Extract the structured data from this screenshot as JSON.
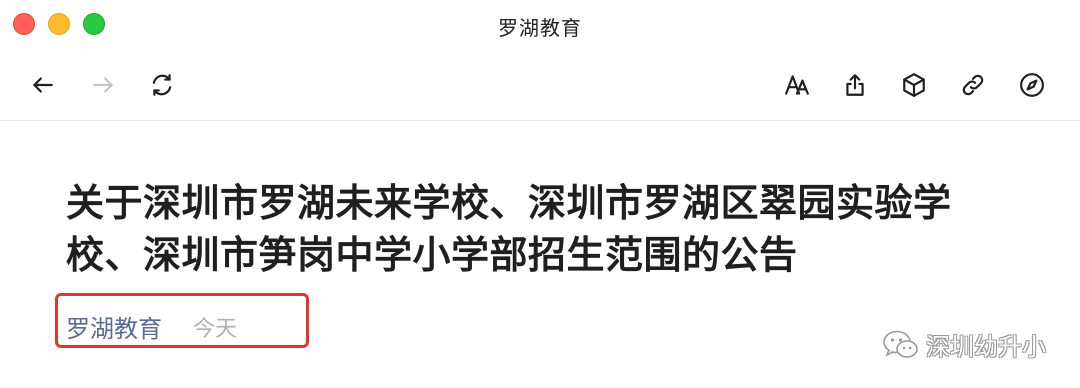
{
  "window": {
    "title": "罗湖教育"
  },
  "toolbar": {
    "back_icon": "arrow-left-icon",
    "forward_icon": "arrow-right-icon",
    "reload_icon": "reload-icon",
    "font_icon": "font-size-icon",
    "share_icon": "share-icon",
    "box_icon": "cube-icon",
    "link_icon": "link-icon",
    "compass_icon": "compass-icon"
  },
  "article": {
    "title": "关于深圳市罗湖未来学校、深圳市罗湖区翠园实验学校、深圳市笋岗中学小学部招生范围的公告",
    "author": "罗湖教育",
    "date": "今天",
    "highlight_color": "#e0362b",
    "watermark": "深圳幼升小"
  }
}
